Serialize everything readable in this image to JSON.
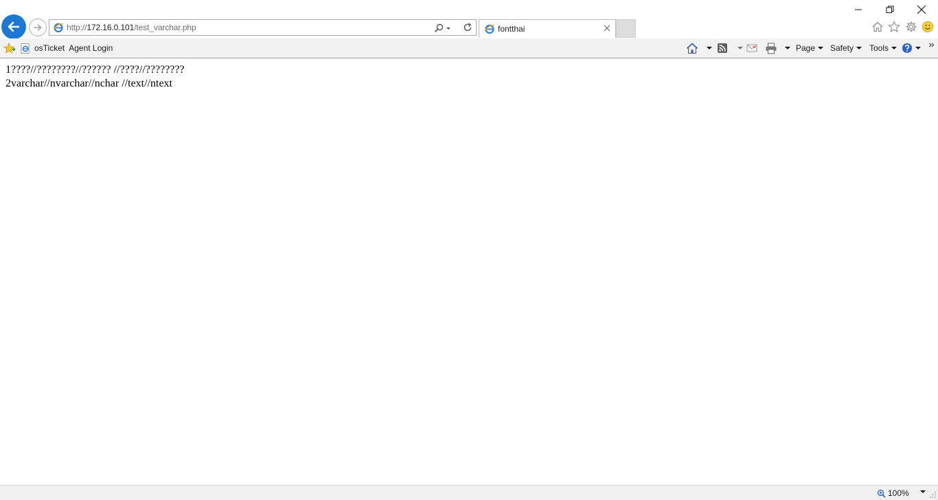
{
  "window": {
    "controls": {
      "minimize_icon": "minimize-icon",
      "restore_icon": "restore-icon",
      "close_icon": "close-icon"
    }
  },
  "navigation": {
    "back_icon": "back-arrow-icon",
    "forward_icon": "forward-arrow-icon",
    "address": {
      "scheme": "http://",
      "host": "172.16.0.101",
      "path": "/test_varchar.php",
      "search_icon": "search-icon",
      "refresh_icon": "refresh-icon"
    }
  },
  "tabs": [
    {
      "title": "fontthai",
      "active": true,
      "favicon": "ie-page-icon",
      "close_icon": "close-icon"
    }
  ],
  "toolbar_right_icons": [
    "home-icon",
    "favorites-star-icon",
    "settings-gear-icon",
    "feedback-smiley-icon"
  ],
  "favorites_bar": {
    "items": [
      {
        "label": "osTicket  Agent Login",
        "icon": "ie-page-icon"
      }
    ]
  },
  "command_bar": {
    "page_label": "Page",
    "safety_label": "Safety",
    "tools_label": "Tools",
    "icons": [
      "home-icon",
      "feeds-icon",
      "read-mail-icon",
      "print-icon",
      "help-icon",
      "chevron-more-icon"
    ]
  },
  "content": {
    "lines": [
      "1????//????????//?????? //????//????????",
      "2varchar//nvarchar//nchar //text//ntext"
    ]
  },
  "status_bar": {
    "zoom": "100%"
  },
  "colors": {
    "accent": "#1e78d2",
    "command_bar_bg": "#f2f2f2",
    "status_bar_bg": "#f0f0f0"
  }
}
